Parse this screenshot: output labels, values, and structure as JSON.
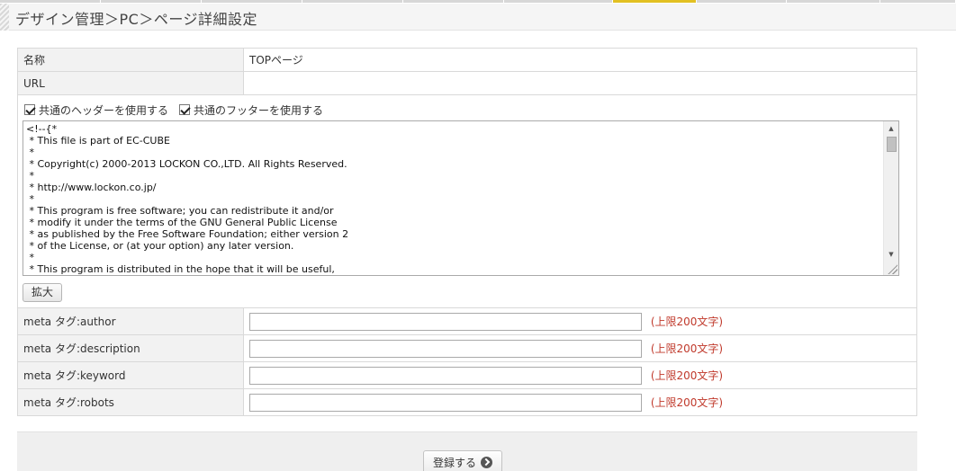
{
  "header": {
    "title": "デザイン管理＞PC＞ページ詳細設定"
  },
  "form": {
    "name_label": "名称",
    "name_value": "TOPページ",
    "url_label": "URL",
    "url_value": "",
    "header_checkbox_label": "共通のヘッダーを使用する",
    "header_checked": true,
    "footer_checkbox_label": "共通のフッターを使用する",
    "footer_checked": true,
    "template_code": "<!--{*\n * This file is part of EC-CUBE\n *\n * Copyright(c) 2000-2013 LOCKON CO.,LTD. All Rights Reserved.\n *\n * http://www.lockon.co.jp/\n *\n * This program is free software; you can redistribute it and/or\n * modify it under the terms of the GNU General Public License\n * as published by the Free Software Foundation; either version 2\n * of the License, or (at your option) any later version.\n *\n * This program is distributed in the hope that it will be useful,",
    "expand_button": "拡大",
    "meta_rows": [
      {
        "label": "meta タグ:author",
        "value": "",
        "limit": "(上限200文字)"
      },
      {
        "label": "meta タグ:description",
        "value": "",
        "limit": "(上限200文字)"
      },
      {
        "label": "meta タグ:keyword",
        "value": "",
        "limit": "(上限200文字)"
      },
      {
        "label": "meta タグ:robots",
        "value": "",
        "limit": "(上限200文字)"
      }
    ]
  },
  "footer": {
    "submit_label": "登録する"
  }
}
